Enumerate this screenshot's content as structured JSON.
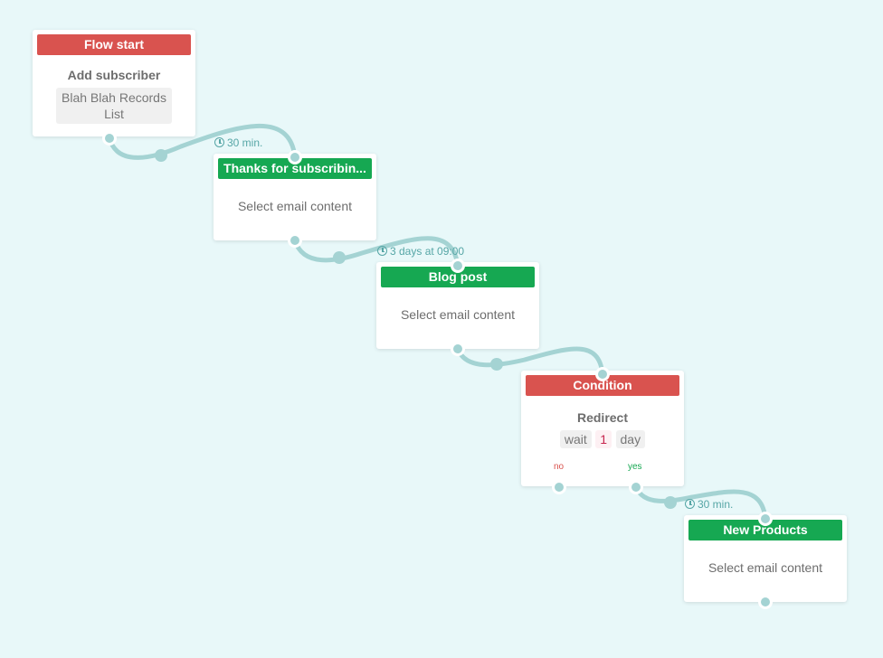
{
  "colors": {
    "red": "#d9534f",
    "green": "#16a852",
    "link": "#a4d3d3",
    "delay_text": "#56a6a6",
    "background": "#e8f8f9"
  },
  "nodes": {
    "flow_start": {
      "header": "Flow start",
      "title": "Add subscriber",
      "tag": "Blah Blah Records List"
    },
    "thanks": {
      "header": "Thanks for subscribin...",
      "body": "Select email content"
    },
    "blog": {
      "header": "Blog post",
      "body": "Select email content"
    },
    "condition": {
      "header": "Condition",
      "title": "Redirect",
      "wait_label": "wait",
      "wait_value": "1",
      "wait_unit": "day",
      "no_label": "no",
      "yes_label": "yes"
    },
    "new_products": {
      "header": "New Products",
      "body": "Select email content"
    }
  },
  "delays": {
    "d1": {
      "icon": "clock-icon",
      "text": "30 min."
    },
    "d2": {
      "icon": "clock-icon",
      "text": "3 days at 09:00"
    },
    "d3": {
      "icon": "clock-icon",
      "text": "30 min."
    }
  }
}
